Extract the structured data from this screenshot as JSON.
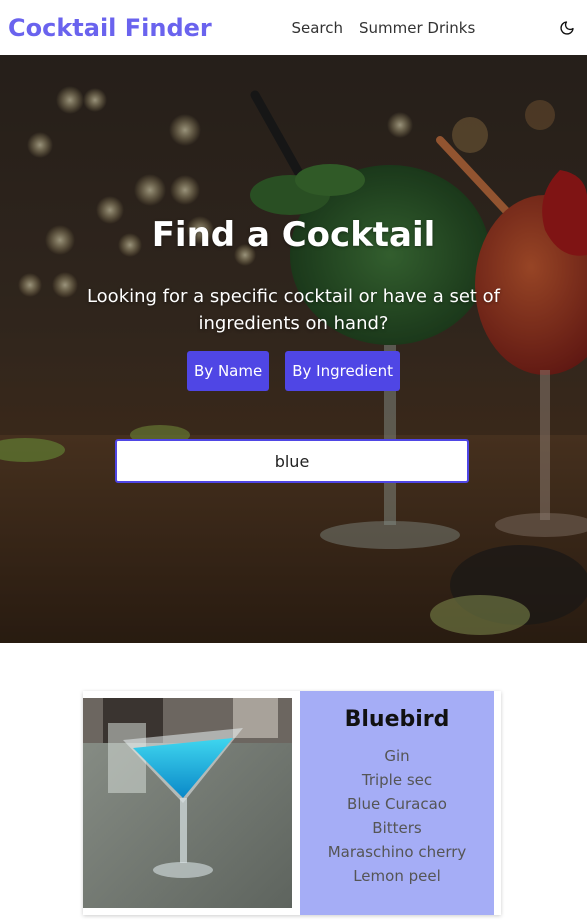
{
  "header": {
    "brand": "Cocktail Finder",
    "nav": [
      "Search",
      "Summer Drinks"
    ],
    "theme_icon": "moon-icon"
  },
  "hero": {
    "title": "Find a Cocktail",
    "subtitle": "Looking for a specific cocktail or have a set of ingredients on hand?",
    "buttons": [
      "By Name",
      "By Ingredient"
    ],
    "search_value": "blue"
  },
  "results": [
    {
      "name": "Bluebird",
      "ingredients": [
        "Gin",
        "Triple sec",
        "Blue Curacao",
        "Bitters",
        "Maraschino cherry",
        "Lemon peel"
      ]
    }
  ],
  "colors": {
    "brand": "#6a63ee",
    "button": "#4f46e5",
    "card_body": "#a5adf6"
  }
}
